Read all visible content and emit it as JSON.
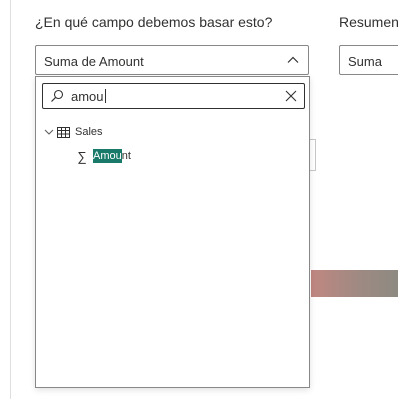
{
  "labels": {
    "question": "¿En qué campo debemos basar esto?",
    "summary": "Resumen"
  },
  "field_select": {
    "value": "Suma de Amount",
    "expanded": true
  },
  "summary_select": {
    "value": "Suma"
  },
  "search": {
    "value": "amou"
  },
  "tree": {
    "table": {
      "label": "Sales",
      "expanded": true
    },
    "field": {
      "match": "Amou",
      "rest": "nt"
    }
  },
  "colors": {
    "highlight": "#1a7a6a",
    "gradient_start": "#c08781",
    "gradient_end": "#8d8a82"
  }
}
